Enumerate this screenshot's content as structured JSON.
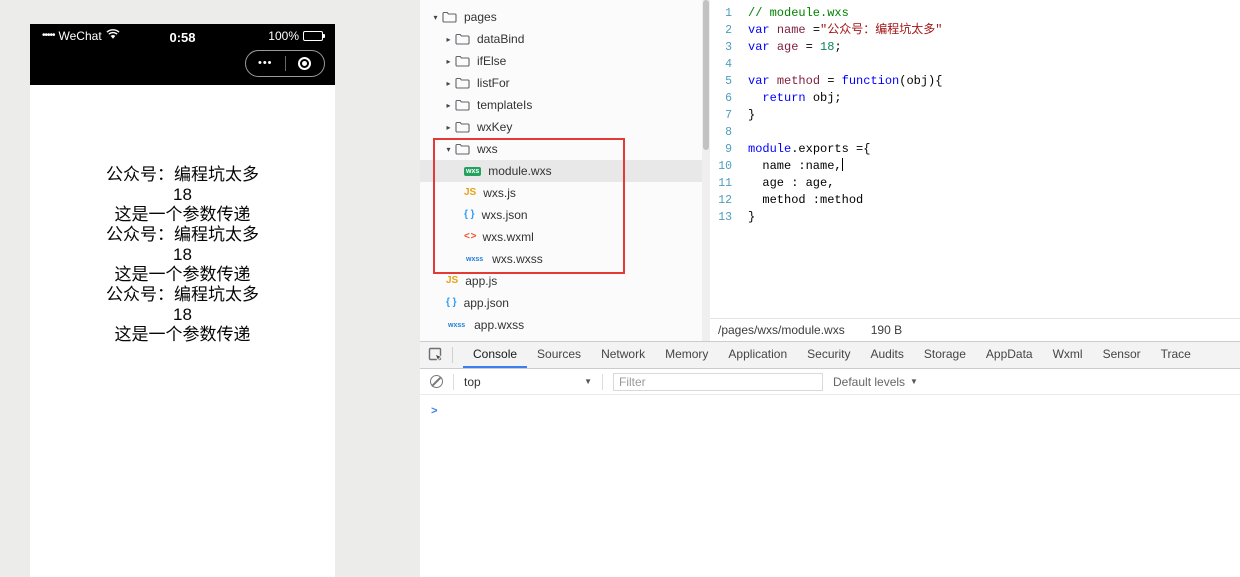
{
  "simulator": {
    "statusbar": {
      "carrier_dots": "•••••",
      "carrier": "WeChat",
      "time": "0:58",
      "battery": "100%"
    },
    "capsule": {
      "more": "•••"
    },
    "content_lines": [
      "公众号：编程坑太多",
      "18",
      "这是一个参数传递",
      "公众号：编程坑太多",
      "18",
      "这是一个参数传递",
      "公众号：编程坑太多",
      "18",
      "这是一个参数传递"
    ]
  },
  "file_tree": {
    "items": [
      {
        "label": "pages",
        "type": "folder",
        "state": "open",
        "depth": 0
      },
      {
        "label": "dataBind",
        "type": "folder",
        "state": "closed",
        "depth": 1
      },
      {
        "label": "ifElse",
        "type": "folder",
        "state": "closed",
        "depth": 1
      },
      {
        "label": "listFor",
        "type": "folder",
        "state": "closed",
        "depth": 1
      },
      {
        "label": "templateIs",
        "type": "folder",
        "state": "closed",
        "depth": 1
      },
      {
        "label": "wxKey",
        "type": "folder",
        "state": "closed",
        "depth": 1
      },
      {
        "label": "wxs",
        "type": "folder",
        "state": "open",
        "depth": 1
      },
      {
        "label": "module.wxs",
        "type": "file",
        "icon": "wxs",
        "depth": 2,
        "selected": true
      },
      {
        "label": "wxs.js",
        "type": "file",
        "icon": "js",
        "depth": 2
      },
      {
        "label": "wxs.json",
        "type": "file",
        "icon": "json",
        "depth": 2
      },
      {
        "label": "wxs.wxml",
        "type": "file",
        "icon": "wxml",
        "depth": 2
      },
      {
        "label": "wxs.wxss",
        "type": "file",
        "icon": "wxss",
        "depth": 2
      },
      {
        "label": "app.js",
        "type": "file",
        "icon": "js",
        "depth": 0
      },
      {
        "label": "app.json",
        "type": "file",
        "icon": "json",
        "depth": 0
      },
      {
        "label": "app.wxss",
        "type": "file",
        "icon": "wxss",
        "depth": 0
      }
    ],
    "file_icon_labels": {
      "wxs": "wxs",
      "js": "JS",
      "json": "{ }",
      "wxml": "< >",
      "wxss": "wxss"
    },
    "annotation_color": "#e53935"
  },
  "editor": {
    "lines": [
      {
        "n": "1",
        "s": [
          [
            "// modeule.wxs",
            "comment"
          ]
        ]
      },
      {
        "n": "2",
        "s": [
          [
            "var",
            "keyword"
          ],
          [
            " ",
            ""
          ],
          [
            "name",
            "variable"
          ],
          [
            " =",
            ""
          ],
          [
            "\"公众号：编程坑太多\"",
            "string"
          ]
        ]
      },
      {
        "n": "3",
        "s": [
          [
            "var",
            "keyword"
          ],
          [
            " ",
            ""
          ],
          [
            "age",
            "variable"
          ],
          [
            " = ",
            ""
          ],
          [
            "18",
            "number"
          ],
          [
            ";",
            ""
          ]
        ]
      },
      {
        "n": "4",
        "s": []
      },
      {
        "n": "5",
        "s": [
          [
            "var",
            "keyword"
          ],
          [
            " ",
            ""
          ],
          [
            "method",
            "variable"
          ],
          [
            " = ",
            ""
          ],
          [
            "function",
            "keyword"
          ],
          [
            "(obj){",
            ""
          ]
        ]
      },
      {
        "n": "6",
        "s": [
          [
            "  ",
            ""
          ],
          [
            "return",
            "keyword"
          ],
          [
            " obj;",
            ""
          ]
        ]
      },
      {
        "n": "7",
        "s": [
          [
            "}",
            ""
          ]
        ]
      },
      {
        "n": "8",
        "s": []
      },
      {
        "n": "9",
        "s": [
          [
            "module",
            "keyword"
          ],
          [
            ".exports ={",
            ""
          ]
        ]
      },
      {
        "n": "10",
        "s": [
          [
            "  name :name,",
            ""
          ]
        ],
        "cursor": true
      },
      {
        "n": "11",
        "s": [
          [
            "  age : age,",
            ""
          ]
        ]
      },
      {
        "n": "12",
        "s": [
          [
            "  method :method",
            ""
          ]
        ]
      },
      {
        "n": "13",
        "s": [
          [
            "}",
            ""
          ]
        ]
      }
    ],
    "syntax_colors": {
      "comment": "#008000",
      "keyword": "#0000ff",
      "variable": "#811f3f",
      "string": "#a31515",
      "number": "#098658",
      "line_number": "#4e9dbd"
    },
    "status": {
      "path": "/pages/wxs/module.wxs",
      "size": "190 B"
    }
  },
  "devtools": {
    "tabs": [
      "Console",
      "Sources",
      "Network",
      "Memory",
      "Application",
      "Security",
      "Audits",
      "Storage",
      "AppData",
      "Wxml",
      "Sensor",
      "Trace"
    ],
    "active_tab": "Console",
    "toolbar": {
      "context": "top",
      "filter_placeholder": "Filter",
      "levels": "Default levels"
    },
    "accent_color": "#3b7ef0"
  },
  "icons": {
    "caret_open": "▾",
    "caret_closed": "▸",
    "dropdown_caret": "▼",
    "prompt": ">"
  }
}
